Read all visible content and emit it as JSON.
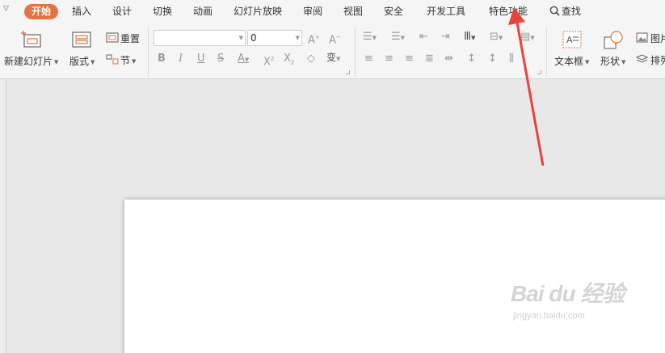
{
  "tabs": [
    {
      "label": "开始",
      "active": true
    },
    {
      "label": "插入"
    },
    {
      "label": "设计"
    },
    {
      "label": "切换"
    },
    {
      "label": "动画"
    },
    {
      "label": "幻灯片放映"
    },
    {
      "label": "审阅"
    },
    {
      "label": "视图"
    },
    {
      "label": "安全"
    },
    {
      "label": "开发工具"
    },
    {
      "label": "特色功能"
    }
  ],
  "search": {
    "label": "查找",
    "icon": "search-icon"
  },
  "ribbon": {
    "new_slide": "新建幻灯片",
    "layout": "版式",
    "reset": "重置",
    "section": "节",
    "font_name": "",
    "font_size": "0",
    "textbox": "文本框",
    "shape": "形状",
    "picture": "图片",
    "arrange": "排列"
  },
  "watermark": {
    "logo": "Bai du 经验",
    "url": "jingyan.baidu.com"
  },
  "colors": {
    "accent": "#e4733f",
    "arrow": "#e8433a",
    "ribbon_bg": "#f5f5f5",
    "workspace_bg": "#e8e8e8"
  }
}
